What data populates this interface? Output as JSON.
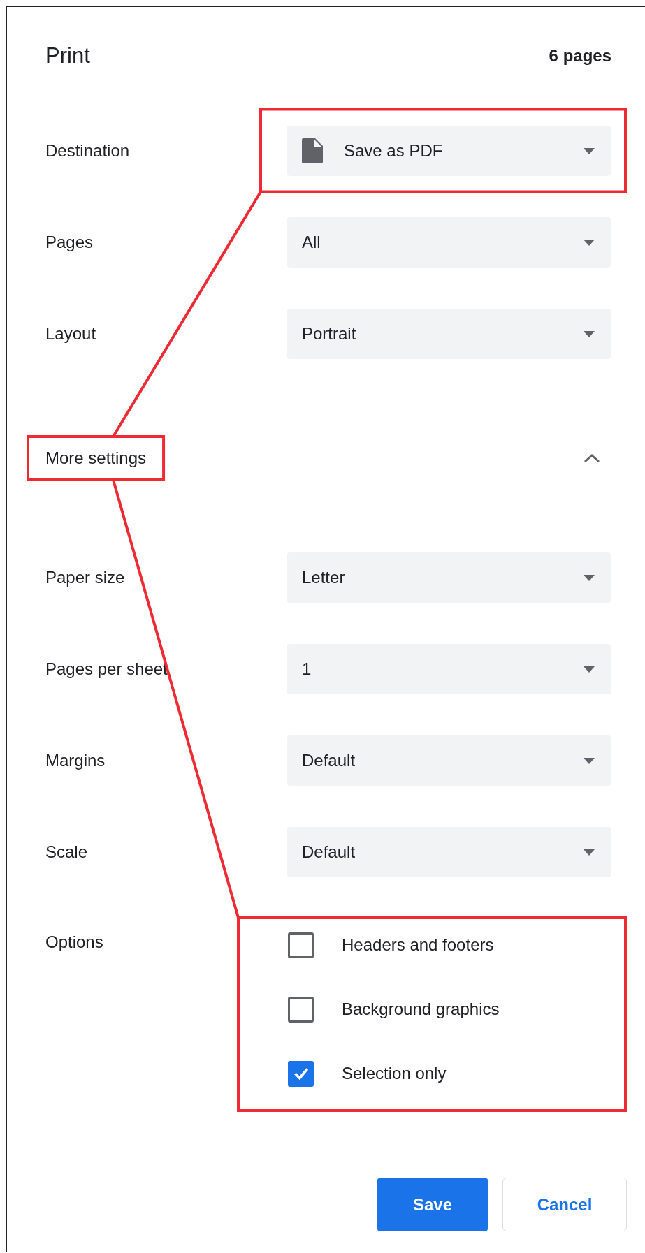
{
  "dialog": {
    "title": "Print",
    "page_count": "6 pages"
  },
  "settings": [
    {
      "label": "Destination",
      "value": "Save as PDF"
    },
    {
      "label": "Pages",
      "value": "All"
    },
    {
      "label": "Layout",
      "value": "Portrait"
    }
  ],
  "more_settings": {
    "label": "More settings",
    "expanded": true
  },
  "advanced_settings": [
    {
      "label": "Paper size",
      "value": "Letter"
    },
    {
      "label": "Pages per sheet",
      "value": "1"
    },
    {
      "label": "Margins",
      "value": "Default"
    },
    {
      "label": "Scale",
      "value": "Default"
    }
  ],
  "options": {
    "label": "Options",
    "items": [
      {
        "label": "Headers and footers",
        "checked": false
      },
      {
        "label": "Background graphics",
        "checked": false
      },
      {
        "label": "Selection only",
        "checked": true
      }
    ]
  },
  "buttons": [
    {
      "label": "Save",
      "kind": "primary"
    },
    {
      "label": "Cancel",
      "kind": "secondary"
    }
  ]
}
